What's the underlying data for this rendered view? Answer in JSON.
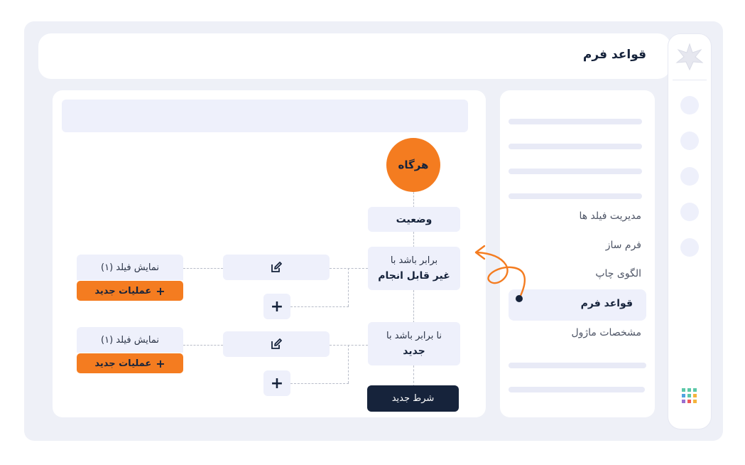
{
  "header": {
    "title": "قواعد فرم"
  },
  "sidebar": {
    "items": [
      {
        "label": "مدیریت فیلد ها"
      },
      {
        "label": "فرم ساز"
      },
      {
        "label": "الگوی چاپ"
      },
      {
        "label": "قواعد فرم",
        "active": true
      },
      {
        "label": "مشخصات ماژول"
      }
    ]
  },
  "flow": {
    "trigger": "هرگاه",
    "status": "وضعیت",
    "conditions": [
      {
        "line1": "برابر باشد با",
        "line2": "غیر قابل انجام"
      },
      {
        "line1": "نا برابر باشد با",
        "line2": "جدید"
      }
    ],
    "actions": [
      {
        "field": "نمایش فیلد (۱)",
        "new_action": "عملیات جدید"
      },
      {
        "field": "نمایش فیلد (۱)",
        "new_action": "عملیات جدید"
      }
    ],
    "new_condition": "شرط جدید",
    "plus": "+"
  },
  "colors": {
    "accent": "#f47c20",
    "dark": "#16233b",
    "node_bg": "#eef0fb"
  }
}
